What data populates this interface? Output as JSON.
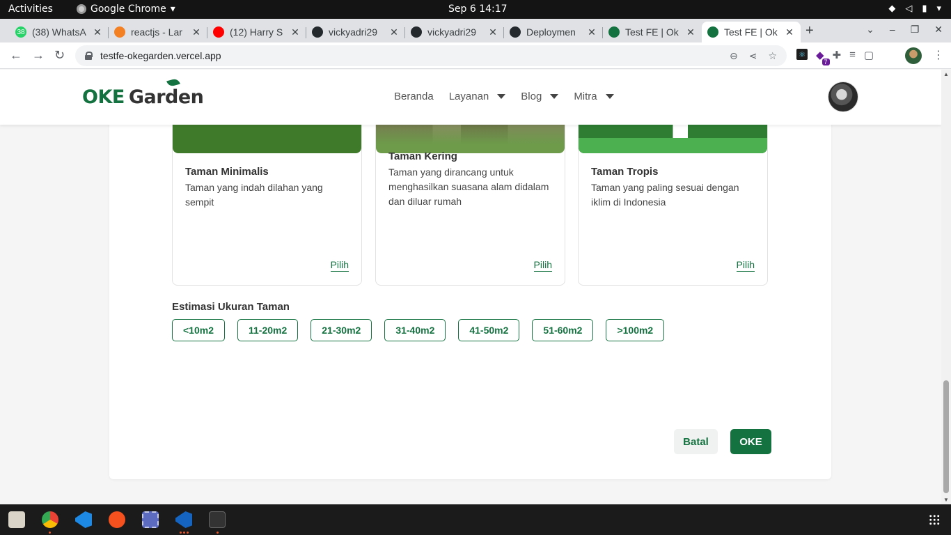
{
  "system": {
    "activities": "Activities",
    "app_name": "Google Chrome",
    "clock": "Sep 6  14:17"
  },
  "browser": {
    "tabs": [
      {
        "title": "(38) WhatsA",
        "favicon": "whatsapp-icon",
        "color": "#25d366",
        "badge": "38"
      },
      {
        "title": "reactjs - Lar",
        "favicon": "stackoverflow-icon",
        "color": "#f48024",
        "badge": ""
      },
      {
        "title": "(12) Harry S",
        "favicon": "youtube-icon",
        "color": "#ff0000",
        "badge": ""
      },
      {
        "title": "vickyadri29",
        "favicon": "github-icon",
        "color": "#24292e",
        "badge": ""
      },
      {
        "title": "vickyadri29",
        "favicon": "github-icon",
        "color": "#24292e",
        "badge": ""
      },
      {
        "title": "Deploymen",
        "favicon": "github-icon",
        "color": "#24292e",
        "badge": ""
      },
      {
        "title": "Test FE | Ok",
        "favicon": "leaf-icon",
        "color": "#13723f",
        "badge": ""
      },
      {
        "title": "Test FE | Ok",
        "favicon": "leaf-icon",
        "color": "#13723f",
        "badge": ""
      }
    ],
    "active_tab": 7,
    "url": "testfe-okegarden.vercel.app",
    "extension_badge": "7"
  },
  "site": {
    "logo_oke": "OKE",
    "logo_garden": "Garden",
    "nav": [
      {
        "label": "Beranda",
        "dropdown": false
      },
      {
        "label": "Layanan",
        "dropdown": true
      },
      {
        "label": "Blog",
        "dropdown": true
      },
      {
        "label": "Mitra",
        "dropdown": true
      }
    ],
    "brand_color": "#13723f"
  },
  "garden_types": [
    {
      "title": "Taman Minimalis",
      "description": "Taman yang indah dilahan yang sempit",
      "action": "Pilih"
    },
    {
      "title": "Taman Kering",
      "description": "Taman yang dirancang untuk menghasilkan suasana alam didalam dan diluar rumah",
      "action": "Pilih"
    },
    {
      "title": "Taman Tropis",
      "description": "Taman yang paling sesuai dengan iklim di Indonesia",
      "action": "Pilih"
    }
  ],
  "size_section": {
    "label": "Estimasi Ukuran Taman",
    "options": [
      "<10m2",
      "11-20m2",
      "21-30m2",
      "31-40m2",
      "41-50m2",
      "51-60m2",
      ">100m2"
    ]
  },
  "actions": {
    "cancel": "Batal",
    "confirm": "OKE"
  }
}
